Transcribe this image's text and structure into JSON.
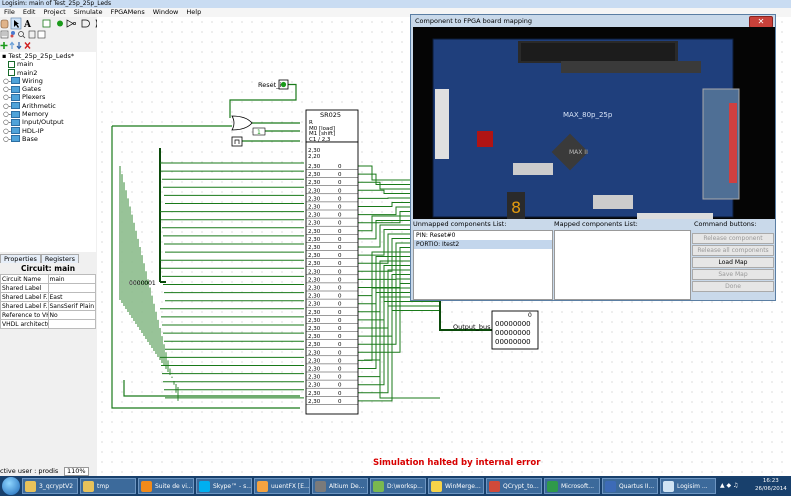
{
  "window": {
    "title": "Logisim: main of Test_25p_25p_Leds"
  },
  "menu": [
    "File",
    "Edit",
    "Project",
    "Simulate",
    "FPGAMens",
    "Window",
    "Help"
  ],
  "tree": {
    "project": "Test_25p_25p_Leds*",
    "items": [
      {
        "label": "main",
        "kind": "circuit"
      },
      {
        "label": "main2",
        "kind": "circuit"
      },
      {
        "label": "Wiring",
        "kind": "folder"
      },
      {
        "label": "Gates",
        "kind": "folder"
      },
      {
        "label": "Plexers",
        "kind": "folder"
      },
      {
        "label": "Arithmetic",
        "kind": "folder"
      },
      {
        "label": "Memory",
        "kind": "folder"
      },
      {
        "label": "Input/Output",
        "kind": "folder"
      },
      {
        "label": "HDL-IP",
        "kind": "folder"
      },
      {
        "label": "Base",
        "kind": "folder"
      }
    ]
  },
  "properties": {
    "tabs": [
      "Properties",
      "Registers"
    ],
    "title": "Circuit: main",
    "rows": [
      {
        "name": "Circuit Name",
        "value": "main"
      },
      {
        "name": "Shared Label",
        "value": ""
      },
      {
        "name": "Shared Label F...",
        "value": "East"
      },
      {
        "name": "Shared Label F...",
        "value": "SansSerif Plain"
      },
      {
        "name": "Reference to VH...",
        "value": "No"
      },
      {
        "name": "VHDL architectu...",
        "value": ""
      }
    ]
  },
  "status": {
    "active_user": "ctive user : prodis",
    "zoom": "110%"
  },
  "circuit": {
    "reset_label": "Reset_i",
    "register_name": "SR025",
    "register_ports": [
      "R",
      "M0 [load]",
      "M1 [shift]",
      "C1 / 2,3"
    ],
    "input_value": "1",
    "rows": 30,
    "row_left": "2,30",
    "row_right": "0",
    "top_left": "2,30",
    "top_left2": "2,20",
    "counter": "0000001",
    "output_label": "Output_bus_2",
    "display": [
      "0",
      "00000000",
      "00000000",
      "00000000"
    ],
    "halted": "Simulation halted by internal error"
  },
  "dialog": {
    "title": "Component to FPGA board mapping",
    "board_name": "MAX_80p_25p",
    "board_chip": "MAX II",
    "unmapped_header": "Unmapped components List:",
    "mapped_header": "Mapped components List:",
    "commands_header": "Command buttons:",
    "unmapped": [
      "PIN: Reset#0",
      "PORTIO: Itest2"
    ],
    "buttons": [
      {
        "label": "Release component",
        "enabled": false
      },
      {
        "label": "Release all components",
        "enabled": false
      },
      {
        "label": "Load Map",
        "enabled": true
      },
      {
        "label": "Save Map",
        "enabled": false
      },
      {
        "label": "Done",
        "enabled": false
      }
    ]
  },
  "taskbar": {
    "items": [
      {
        "label": "3_qcryptV2",
        "color": "#e8c25a"
      },
      {
        "label": "tmp",
        "color": "#e8c25a"
      },
      {
        "label": "Suite de vi...",
        "color": "#f08a1a"
      },
      {
        "label": "Skype™ - s...",
        "color": "#00aff0"
      },
      {
        "label": "uuentFX [E...",
        "color": "#f4a340"
      },
      {
        "label": "Altium De...",
        "color": "#7a7a7a"
      },
      {
        "label": "D:\\worksp...",
        "color": "#7ab850"
      },
      {
        "label": "WinMerge...",
        "color": "#f6d349"
      },
      {
        "label": "QCrypt_to...",
        "color": "#d04a3a"
      },
      {
        "label": "Microsoft...",
        "color": "#2f9a4a"
      },
      {
        "label": "Quartus II...",
        "color": "#3d6bb7"
      },
      {
        "label": "Logisim ...",
        "color": "#d0e4f4"
      }
    ],
    "clock_time": "16:23",
    "clock_date": "26/06/2014"
  }
}
